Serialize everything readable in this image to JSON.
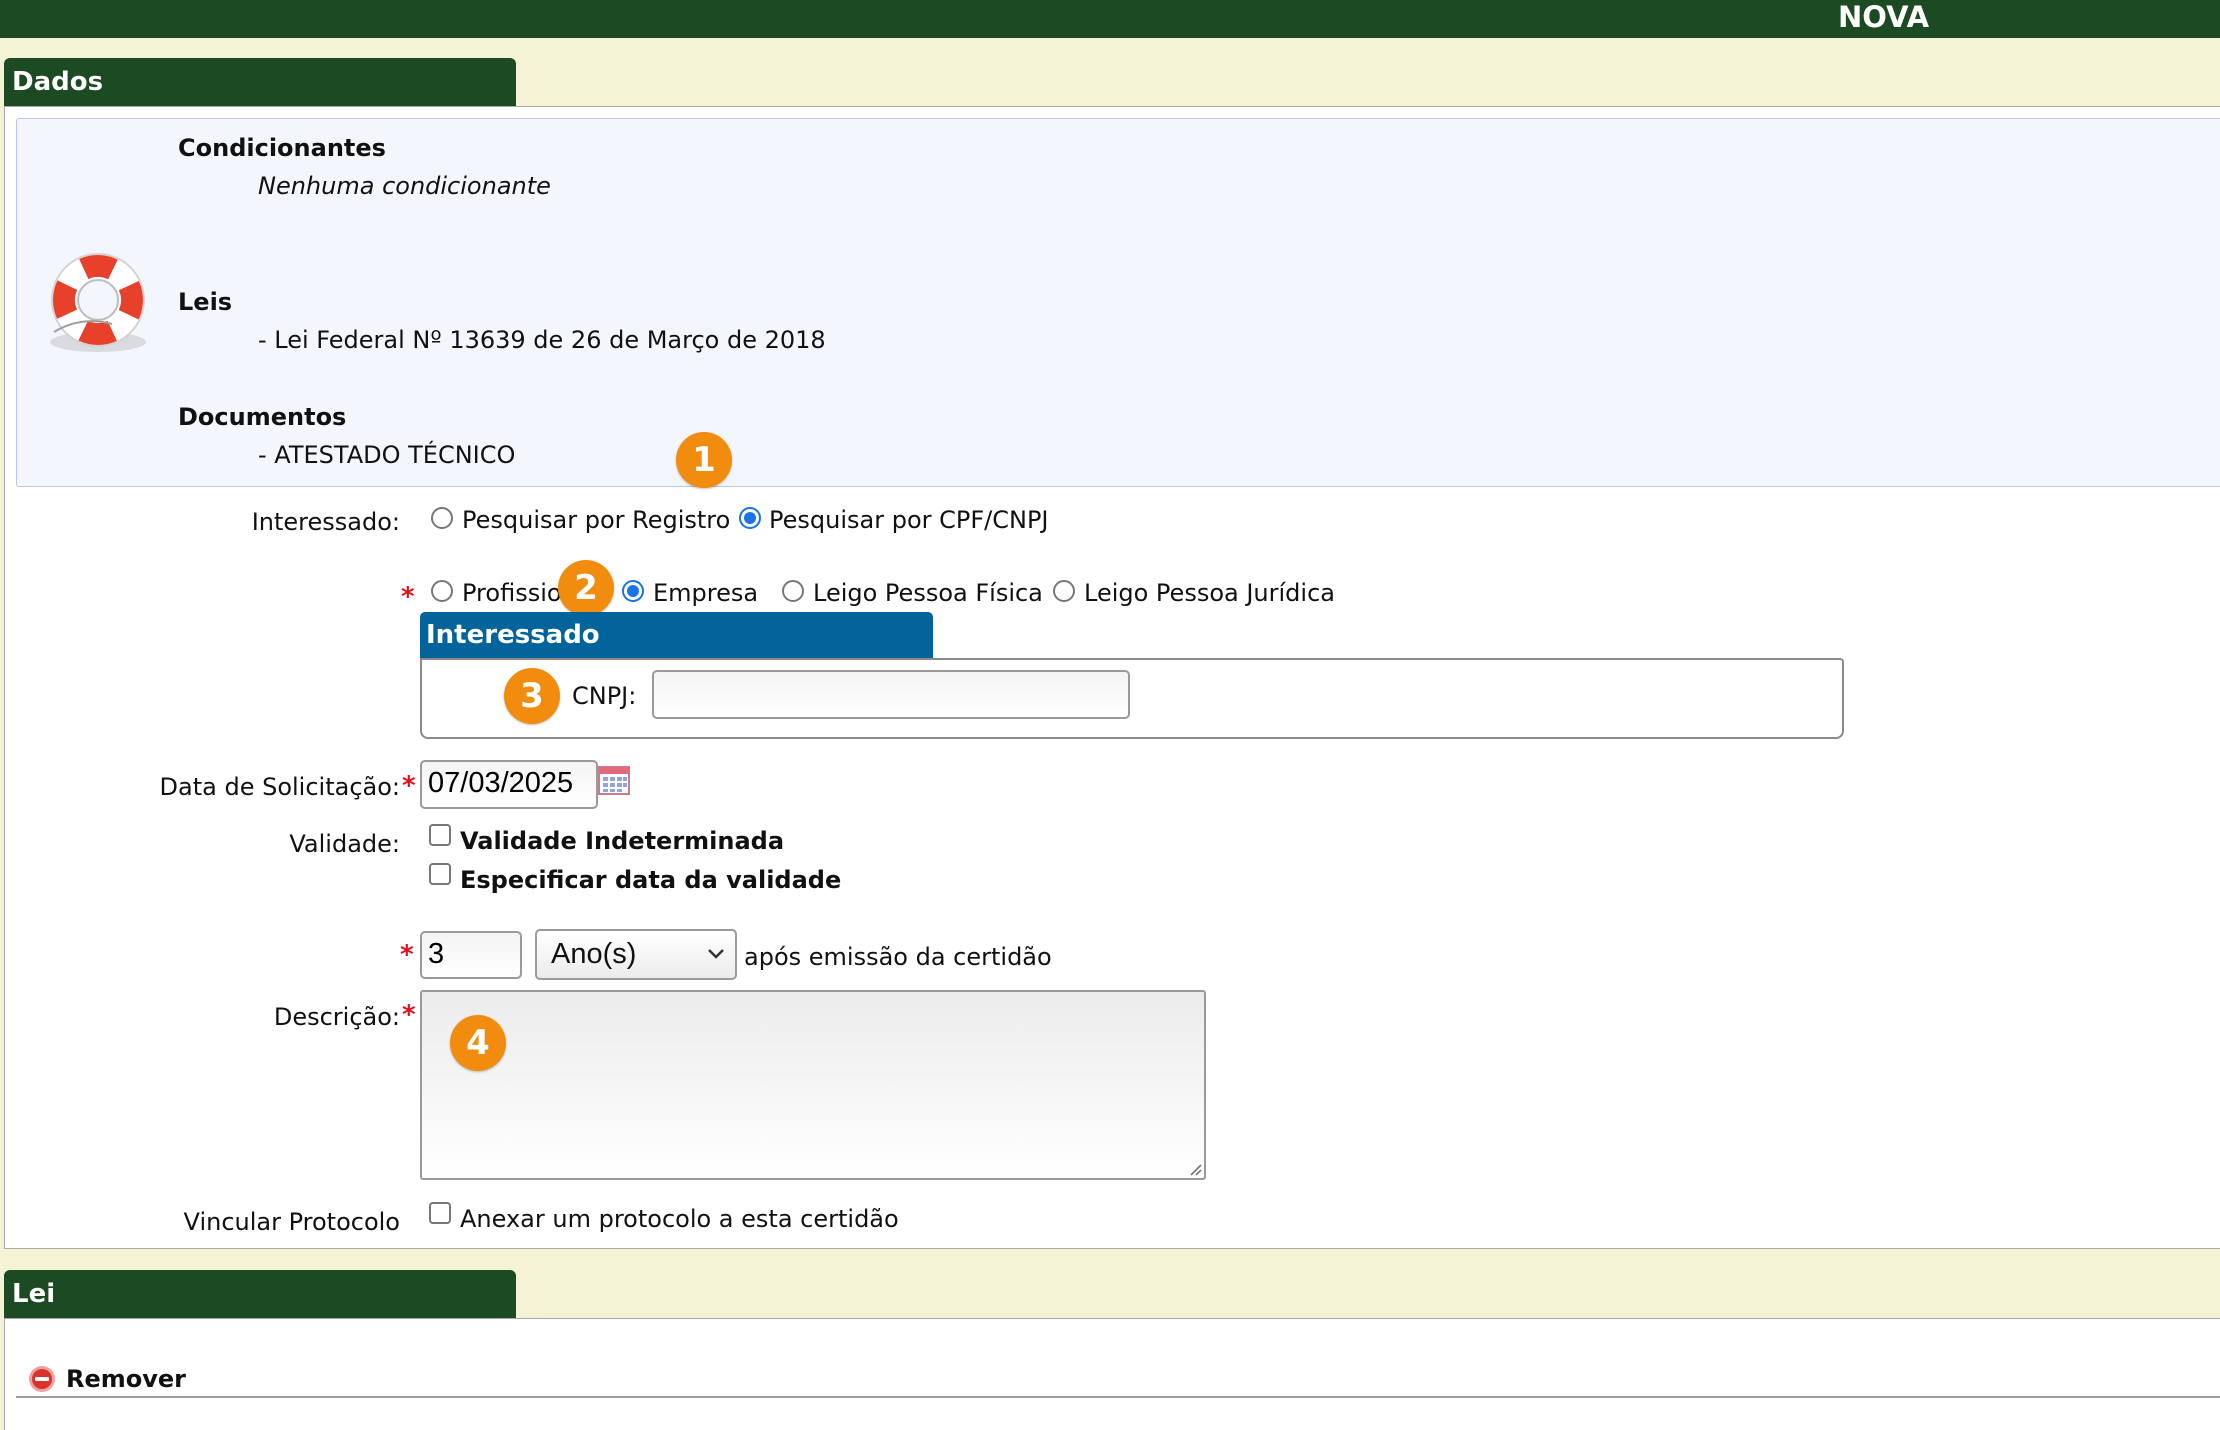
{
  "header": {
    "title": "NOVA"
  },
  "sections": {
    "dados": "Dados",
    "lei": "Lei"
  },
  "info": {
    "condicionantes_title": "Condicionantes",
    "condicionantes_value": "Nenhuma condicionante",
    "leis_title": "Leis",
    "leis_value": "- Lei Federal Nº 13639 de 26 de Março de 2018",
    "documentos_title": "Documentos",
    "documentos_value": "- ATESTADO TÉCNICO"
  },
  "interessado": {
    "label": "Interessado:",
    "search_options": [
      "Pesquisar por Registro",
      "Pesquisar por CPF/CNPJ"
    ],
    "selected_search": "Pesquisar por CPF/CNPJ",
    "type_options": [
      "Profissio",
      "Empresa",
      "Leigo Pessoa Física",
      "Leigo Pessoa Jurídica"
    ],
    "selected_type": "Empresa",
    "panel_title": "Interessado",
    "cnpj_label": "CNPJ:",
    "cnpj_value": ""
  },
  "data_solicitacao": {
    "label": "Data de Solicitação:",
    "value": "07/03/2025"
  },
  "validade": {
    "label": "Validade:",
    "opt_indeterminada": "Validade Indeterminada",
    "opt_especificar": "Especificar data da validade",
    "quantity": "3",
    "unit": "Ano(s)",
    "suffix": "após emissão da certidão"
  },
  "descricao": {
    "label": "Descrição:",
    "value": ""
  },
  "vincular": {
    "label": "Vincular Protocolo",
    "checkbox_label": "Anexar um protocolo a esta certidão"
  },
  "lei_section": {
    "remove_label": "Remover"
  },
  "required_mark": "*",
  "badges": [
    "1",
    "2",
    "3",
    "4"
  ],
  "colors": {
    "header_green": "#1c4a22",
    "page_bg": "#f5f3d6",
    "subpanel_blue": "#02649b",
    "badge_orange": "#f28c0f",
    "required_red": "#e0121b"
  }
}
